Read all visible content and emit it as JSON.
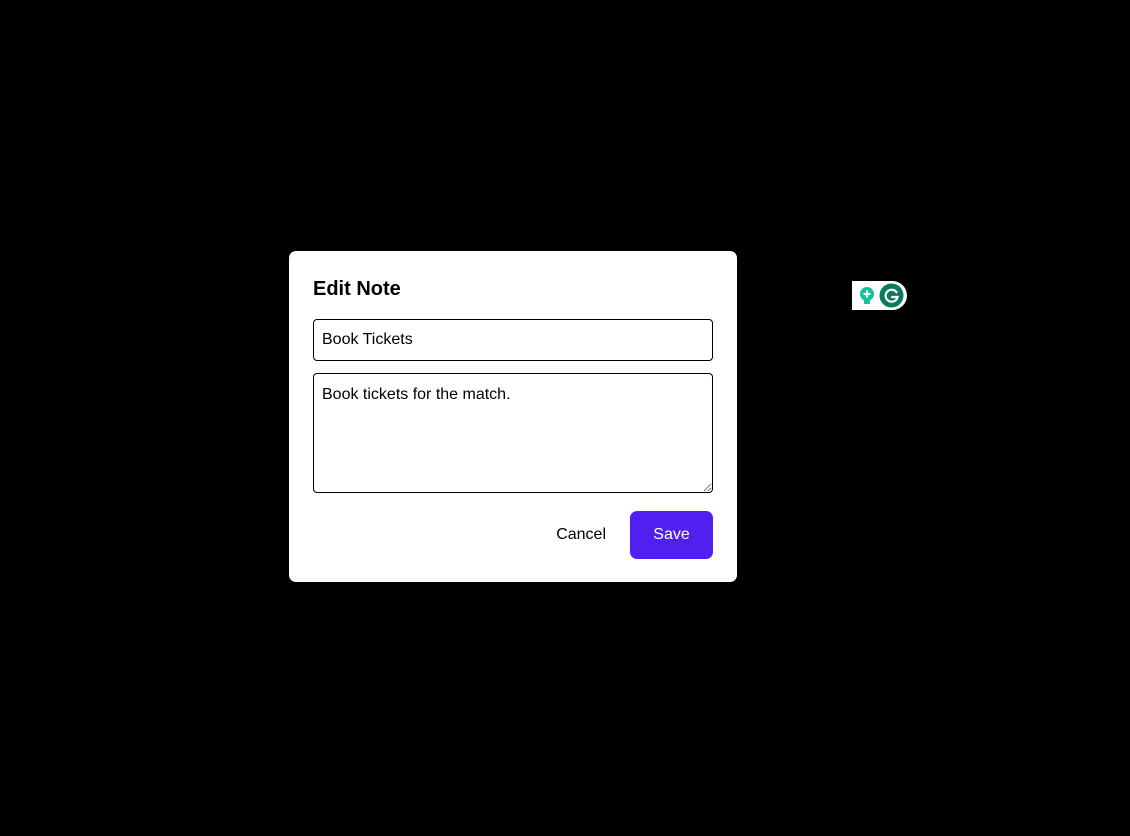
{
  "modal": {
    "title": "Edit Note",
    "title_input_value": "Book Tickets",
    "body_textarea_value": "Book tickets for the match.",
    "cancel_label": "Cancel",
    "save_label": "Save"
  },
  "colors": {
    "backdrop": "#000000",
    "modal_bg": "#ffffff",
    "save_button": "#5120f0",
    "grammarly_green": "#15c39a",
    "grammarly_dark": "#0d8a6a"
  },
  "icons": {
    "bulb": "lightbulb-icon",
    "grammarly": "grammarly-icon"
  }
}
